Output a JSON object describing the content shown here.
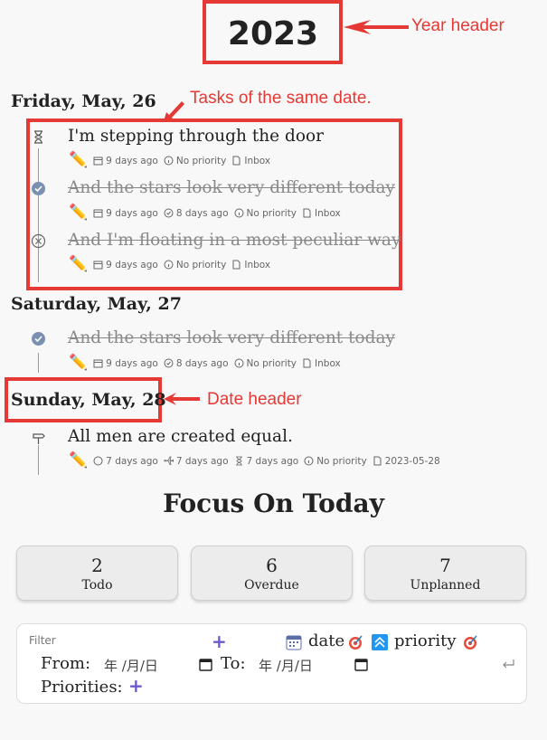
{
  "annotations": {
    "year_header": "Year header",
    "tasks_same_date": "Tasks of the same date.",
    "date_header": "Date header"
  },
  "year": "2023",
  "groups": [
    {
      "date": "Friday, May, 26",
      "tasks": [
        {
          "text": "I'm stepping through the door",
          "status": "in-progress",
          "created": "9 days ago",
          "priority": "No priority",
          "list": "Inbox"
        },
        {
          "text": "And the stars look very different today",
          "status": "done",
          "created": "9 days ago",
          "completed": "8 days ago",
          "priority": "No priority",
          "list": "Inbox"
        },
        {
          "text": "And I'm floating in a most peculiar way",
          "status": "cancelled",
          "created": "9 days ago",
          "priority": "No priority",
          "list": "Inbox"
        }
      ]
    },
    {
      "date": "Saturday, May, 27",
      "tasks": [
        {
          "text": "And the stars look very different today",
          "status": "done",
          "created": "9 days ago",
          "completed": "8 days ago",
          "priority": "No priority",
          "list": "Inbox"
        }
      ]
    },
    {
      "date": "Sunday, May, 28",
      "tasks": [
        {
          "text": "All men are created equal.",
          "status": "todo",
          "start": "7 days ago",
          "scheduled": "7 days ago",
          "due": "7 days ago",
          "priority": "No priority",
          "file": "2023-05-28"
        }
      ]
    }
  ],
  "focus": {
    "title": "Focus On Today",
    "cards": [
      {
        "count": "2",
        "label": "Todo"
      },
      {
        "count": "6",
        "label": "Overdue"
      },
      {
        "count": "7",
        "label": "Unplanned"
      }
    ]
  },
  "filter": {
    "label": "Filter",
    "add": "+",
    "sort_date": "date",
    "sort_priority": "priority",
    "from_label": "From:",
    "to_label": "To:",
    "date_placeholder": "年 /月/日",
    "priorities_label": "Priorities:",
    "priorities_add": "+"
  },
  "colors": {
    "annotation": "#e53935",
    "done_check": "#7b8fb0",
    "accent_plus": "#6a5acd"
  }
}
